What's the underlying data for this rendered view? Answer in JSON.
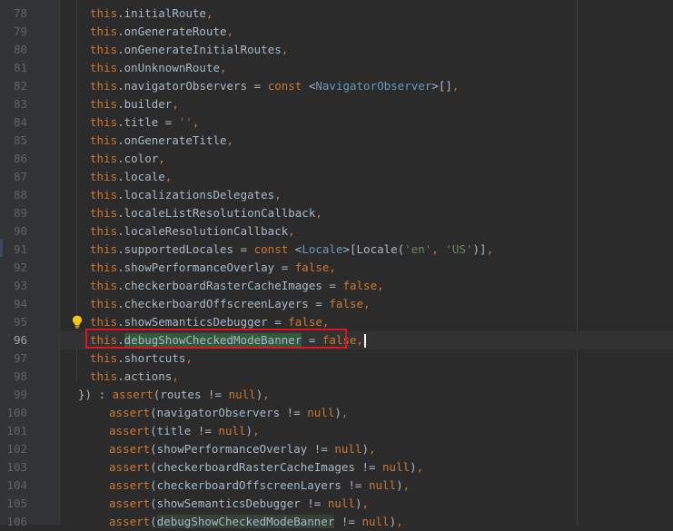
{
  "editor": {
    "current_line": "96",
    "lines": [
      {
        "num": "78",
        "tokens": [
          [
            "kw",
            "this"
          ],
          [
            "prm",
            ".initialRoute"
          ],
          [
            "kw",
            ","
          ]
        ],
        "indent": 33
      },
      {
        "num": "79",
        "tokens": [
          [
            "kw",
            "this"
          ],
          [
            "prm",
            ".onGenerateRoute"
          ],
          [
            "kw",
            ","
          ]
        ],
        "indent": 33
      },
      {
        "num": "80",
        "tokens": [
          [
            "kw",
            "this"
          ],
          [
            "prm",
            ".onGenerateInitialRoutes"
          ],
          [
            "kw",
            ","
          ]
        ],
        "indent": 33
      },
      {
        "num": "81",
        "tokens": [
          [
            "kw",
            "this"
          ],
          [
            "prm",
            ".onUnknownRoute"
          ],
          [
            "kw",
            ","
          ]
        ],
        "indent": 33
      },
      {
        "num": "82",
        "tokens": [
          [
            "kw",
            "this"
          ],
          [
            "prm",
            ".navigatorObservers = "
          ],
          [
            "kw",
            "const "
          ],
          [
            "prm",
            "<"
          ],
          [
            "cls",
            "NavigatorObserver"
          ],
          [
            "prm",
            ">[]"
          ],
          [
            "kw",
            ","
          ]
        ],
        "indent": 33
      },
      {
        "num": "83",
        "tokens": [
          [
            "kw",
            "this"
          ],
          [
            "prm",
            ".builder"
          ],
          [
            "kw",
            ","
          ]
        ],
        "indent": 33
      },
      {
        "num": "84",
        "tokens": [
          [
            "kw",
            "this"
          ],
          [
            "prm",
            ".title = "
          ],
          [
            "str",
            "''"
          ],
          [
            "kw",
            ","
          ]
        ],
        "indent": 33
      },
      {
        "num": "85",
        "tokens": [
          [
            "kw",
            "this"
          ],
          [
            "prm",
            ".onGenerateTitle"
          ],
          [
            "kw",
            ","
          ]
        ],
        "indent": 33
      },
      {
        "num": "86",
        "tokens": [
          [
            "kw",
            "this"
          ],
          [
            "prm",
            ".color"
          ],
          [
            "kw",
            ","
          ]
        ],
        "indent": 33
      },
      {
        "num": "87",
        "tokens": [
          [
            "kw",
            "this"
          ],
          [
            "prm",
            ".locale"
          ],
          [
            "kw",
            ","
          ]
        ],
        "indent": 33
      },
      {
        "num": "88",
        "tokens": [
          [
            "kw",
            "this"
          ],
          [
            "prm",
            ".localizationsDelegates"
          ],
          [
            "kw",
            ","
          ]
        ],
        "indent": 33
      },
      {
        "num": "89",
        "tokens": [
          [
            "kw",
            "this"
          ],
          [
            "prm",
            ".localeListResolutionCallback"
          ],
          [
            "kw",
            ","
          ]
        ],
        "indent": 33
      },
      {
        "num": "90",
        "tokens": [
          [
            "kw",
            "this"
          ],
          [
            "prm",
            ".localeResolutionCallback"
          ],
          [
            "kw",
            ","
          ]
        ],
        "indent": 33
      },
      {
        "num": "91",
        "tokens": [
          [
            "kw",
            "this"
          ],
          [
            "prm",
            ".supportedLocales = "
          ],
          [
            "kw",
            "const "
          ],
          [
            "prm",
            "<"
          ],
          [
            "cls",
            "Locale"
          ],
          [
            "prm",
            ">["
          ],
          [
            "prm",
            "Locale("
          ],
          [
            "str",
            "'en'"
          ],
          [
            "kw",
            ", "
          ],
          [
            "str",
            "'US'"
          ],
          [
            "prm",
            ")]"
          ],
          [
            "kw",
            ","
          ]
        ],
        "indent": 33
      },
      {
        "num": "92",
        "tokens": [
          [
            "kw",
            "this"
          ],
          [
            "prm",
            ".showPerformanceOverlay = "
          ],
          [
            "kw",
            "false"
          ],
          [
            "kw",
            ","
          ]
        ],
        "indent": 33
      },
      {
        "num": "93",
        "tokens": [
          [
            "kw",
            "this"
          ],
          [
            "prm",
            ".checkerboardRasterCacheImages = "
          ],
          [
            "kw",
            "false"
          ],
          [
            "kw",
            ","
          ]
        ],
        "indent": 33
      },
      {
        "num": "94",
        "tokens": [
          [
            "kw",
            "this"
          ],
          [
            "prm",
            ".checkerboardOffscreenLayers = "
          ],
          [
            "kw",
            "false"
          ],
          [
            "kw",
            ","
          ]
        ],
        "indent": 33
      },
      {
        "num": "95",
        "tokens": [
          [
            "kw",
            "this"
          ],
          [
            "prm",
            ".showSemanticsDebugger = "
          ],
          [
            "kw",
            "false"
          ],
          [
            "kw",
            ","
          ]
        ],
        "indent": 33
      },
      {
        "num": "96",
        "tokens": [
          [
            "kw",
            "this"
          ],
          [
            "prm",
            "."
          ],
          [
            "hl-sel",
            "debugShowCheckedModeBanner"
          ],
          [
            "prm",
            " = "
          ],
          [
            "kw",
            "false"
          ],
          [
            "kw",
            ","
          ],
          [
            "caret",
            ""
          ]
        ],
        "indent": 33
      },
      {
        "num": "97",
        "tokens": [
          [
            "kw",
            "this"
          ],
          [
            "prm",
            ".shortcuts"
          ],
          [
            "kw",
            ","
          ]
        ],
        "indent": 33
      },
      {
        "num": "98",
        "tokens": [
          [
            "kw",
            "this"
          ],
          [
            "prm",
            ".actions"
          ],
          [
            "kw",
            ","
          ]
        ],
        "indent": 33
      },
      {
        "num": "99",
        "tokens": [
          [
            "prm",
            "}) : "
          ],
          [
            "kw",
            "assert"
          ],
          [
            "prm",
            "(routes != "
          ],
          [
            "kw",
            "null"
          ],
          [
            "prm",
            ")"
          ],
          [
            "kw",
            ","
          ]
        ],
        "indent": 20
      },
      {
        "num": "100",
        "tokens": [
          [
            "kw",
            "assert"
          ],
          [
            "prm",
            "(navigatorObservers != "
          ],
          [
            "kw",
            "null"
          ],
          [
            "prm",
            ")"
          ],
          [
            "kw",
            ","
          ]
        ],
        "indent": 54
      },
      {
        "num": "101",
        "tokens": [
          [
            "kw",
            "assert"
          ],
          [
            "prm",
            "(title != "
          ],
          [
            "kw",
            "null"
          ],
          [
            "prm",
            ")"
          ],
          [
            "kw",
            ","
          ]
        ],
        "indent": 54
      },
      {
        "num": "102",
        "tokens": [
          [
            "kw",
            "assert"
          ],
          [
            "prm",
            "(showPerformanceOverlay != "
          ],
          [
            "kw",
            "null"
          ],
          [
            "prm",
            ")"
          ],
          [
            "kw",
            ","
          ]
        ],
        "indent": 54
      },
      {
        "num": "103",
        "tokens": [
          [
            "kw",
            "assert"
          ],
          [
            "prm",
            "(checkerboardRasterCacheImages != "
          ],
          [
            "kw",
            "null"
          ],
          [
            "prm",
            ")"
          ],
          [
            "kw",
            ","
          ]
        ],
        "indent": 54
      },
      {
        "num": "104",
        "tokens": [
          [
            "kw",
            "assert"
          ],
          [
            "prm",
            "(checkerboardOffscreenLayers != "
          ],
          [
            "kw",
            "null"
          ],
          [
            "prm",
            ")"
          ],
          [
            "kw",
            ","
          ]
        ],
        "indent": 54
      },
      {
        "num": "105",
        "tokens": [
          [
            "kw",
            "assert"
          ],
          [
            "prm",
            "(showSemanticsDebugger != "
          ],
          [
            "kw",
            "null"
          ],
          [
            "prm",
            ")"
          ],
          [
            "kw",
            ","
          ]
        ],
        "indent": 54
      },
      {
        "num": "106",
        "tokens": [
          [
            "kw",
            "assert"
          ],
          [
            "prm",
            "("
          ],
          [
            "hl-usage2",
            "debugShowCheckedModeBanner"
          ],
          [
            "prm",
            " != "
          ],
          [
            "kw",
            "null"
          ],
          [
            "prm",
            ")"
          ],
          [
            "kw",
            ","
          ]
        ],
        "indent": 54
      }
    ]
  },
  "icons": {
    "bulb": "lightbulb-icon",
    "annotation": "red-highlight-box"
  },
  "colors": {
    "background": "#2b2b2b",
    "keyword": "#cc7832",
    "class": "#6897bb",
    "string": "#6a8759",
    "text": "#a9b7c6",
    "annotation": "#e0141e"
  }
}
